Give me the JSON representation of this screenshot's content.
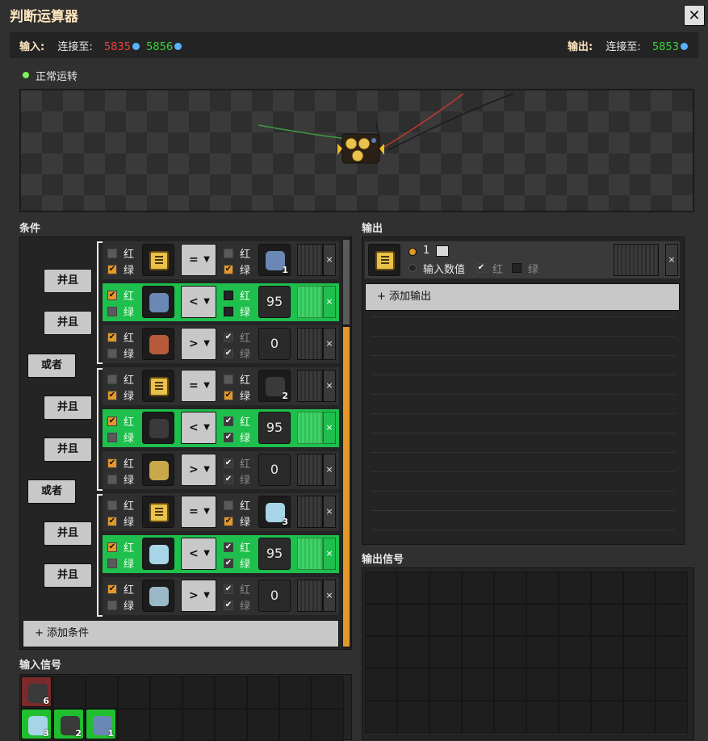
{
  "window": {
    "title": "判断运算器",
    "close": "✕"
  },
  "io": {
    "input_label": "输入:",
    "connected_label": "连接至:",
    "input_red": "5835",
    "input_green": "5856",
    "output_label": "输出:",
    "output_connected_label": "连接至:",
    "output_green": "5853"
  },
  "status": {
    "text": "正常运转",
    "color": "#7ef15a"
  },
  "sections": {
    "conditions": "条件",
    "output": "输出",
    "input_signals": "输入信号",
    "output_signals": "输出信号"
  },
  "labels": {
    "red": "红",
    "green": "绿"
  },
  "logic": {
    "and": "并且",
    "or": "或者"
  },
  "conditions": [
    {
      "red": false,
      "green": true,
      "icon": "combinator-icon",
      "op": "=",
      "cmp_red": false,
      "cmp_green": true,
      "right_icon": "iron-ore-icon",
      "right_badge": "1",
      "highlight": false
    },
    {
      "red": true,
      "green": false,
      "icon": "iron-ore-icon",
      "op": "<",
      "cmp_red": false,
      "cmp_green": false,
      "value": "95",
      "highlight": true
    },
    {
      "red": true,
      "green": false,
      "icon": "copper-ore-icon",
      "op": ">",
      "cmp_red": true,
      "cmp_green": true,
      "value": "0",
      "highlight": false
    },
    {
      "red": false,
      "green": true,
      "icon": "combinator-icon",
      "op": "=",
      "cmp_red": false,
      "cmp_green": true,
      "right_icon": "coal-icon",
      "right_badge": "2",
      "highlight": false
    },
    {
      "red": true,
      "green": false,
      "icon": "coal-icon",
      "op": "<",
      "cmp_red": true,
      "cmp_green": true,
      "value": "95",
      "highlight": true
    },
    {
      "red": true,
      "green": false,
      "icon": "stone-icon",
      "op": ">",
      "cmp_red": true,
      "cmp_green": true,
      "value": "0",
      "highlight": false
    },
    {
      "red": false,
      "green": true,
      "icon": "combinator-icon",
      "op": "=",
      "cmp_red": false,
      "cmp_green": true,
      "right_icon": "ice-icon",
      "right_badge": "3",
      "highlight": false
    },
    {
      "red": true,
      "green": false,
      "icon": "ice-icon",
      "op": "<",
      "cmp_red": true,
      "cmp_green": true,
      "value": "95",
      "highlight": true
    },
    {
      "red": true,
      "green": false,
      "icon": "crystal-icon",
      "op": ">",
      "cmp_red": true,
      "cmp_green": true,
      "value": "0",
      "highlight": false
    }
  ],
  "add_condition": "+ 添加条件",
  "output": {
    "count": "1",
    "input_value_label": "输入数值",
    "red_label": "红",
    "green_label": "绿",
    "add_output": "+ 添加输出"
  },
  "input_signals": [
    {
      "icon": "coal-icon",
      "count": "6",
      "wire": "red"
    },
    {
      "icon": "ice-icon",
      "badge": "3",
      "wire": "green"
    },
    {
      "icon": "coal-icon",
      "badge": "2",
      "wire": "green"
    },
    {
      "icon": "iron-ore-icon",
      "badge": "1",
      "wire": "green"
    }
  ],
  "colors": {
    "accent": "#e39827",
    "green_row": "#1fbf4d",
    "title": "#ffe6c0"
  }
}
